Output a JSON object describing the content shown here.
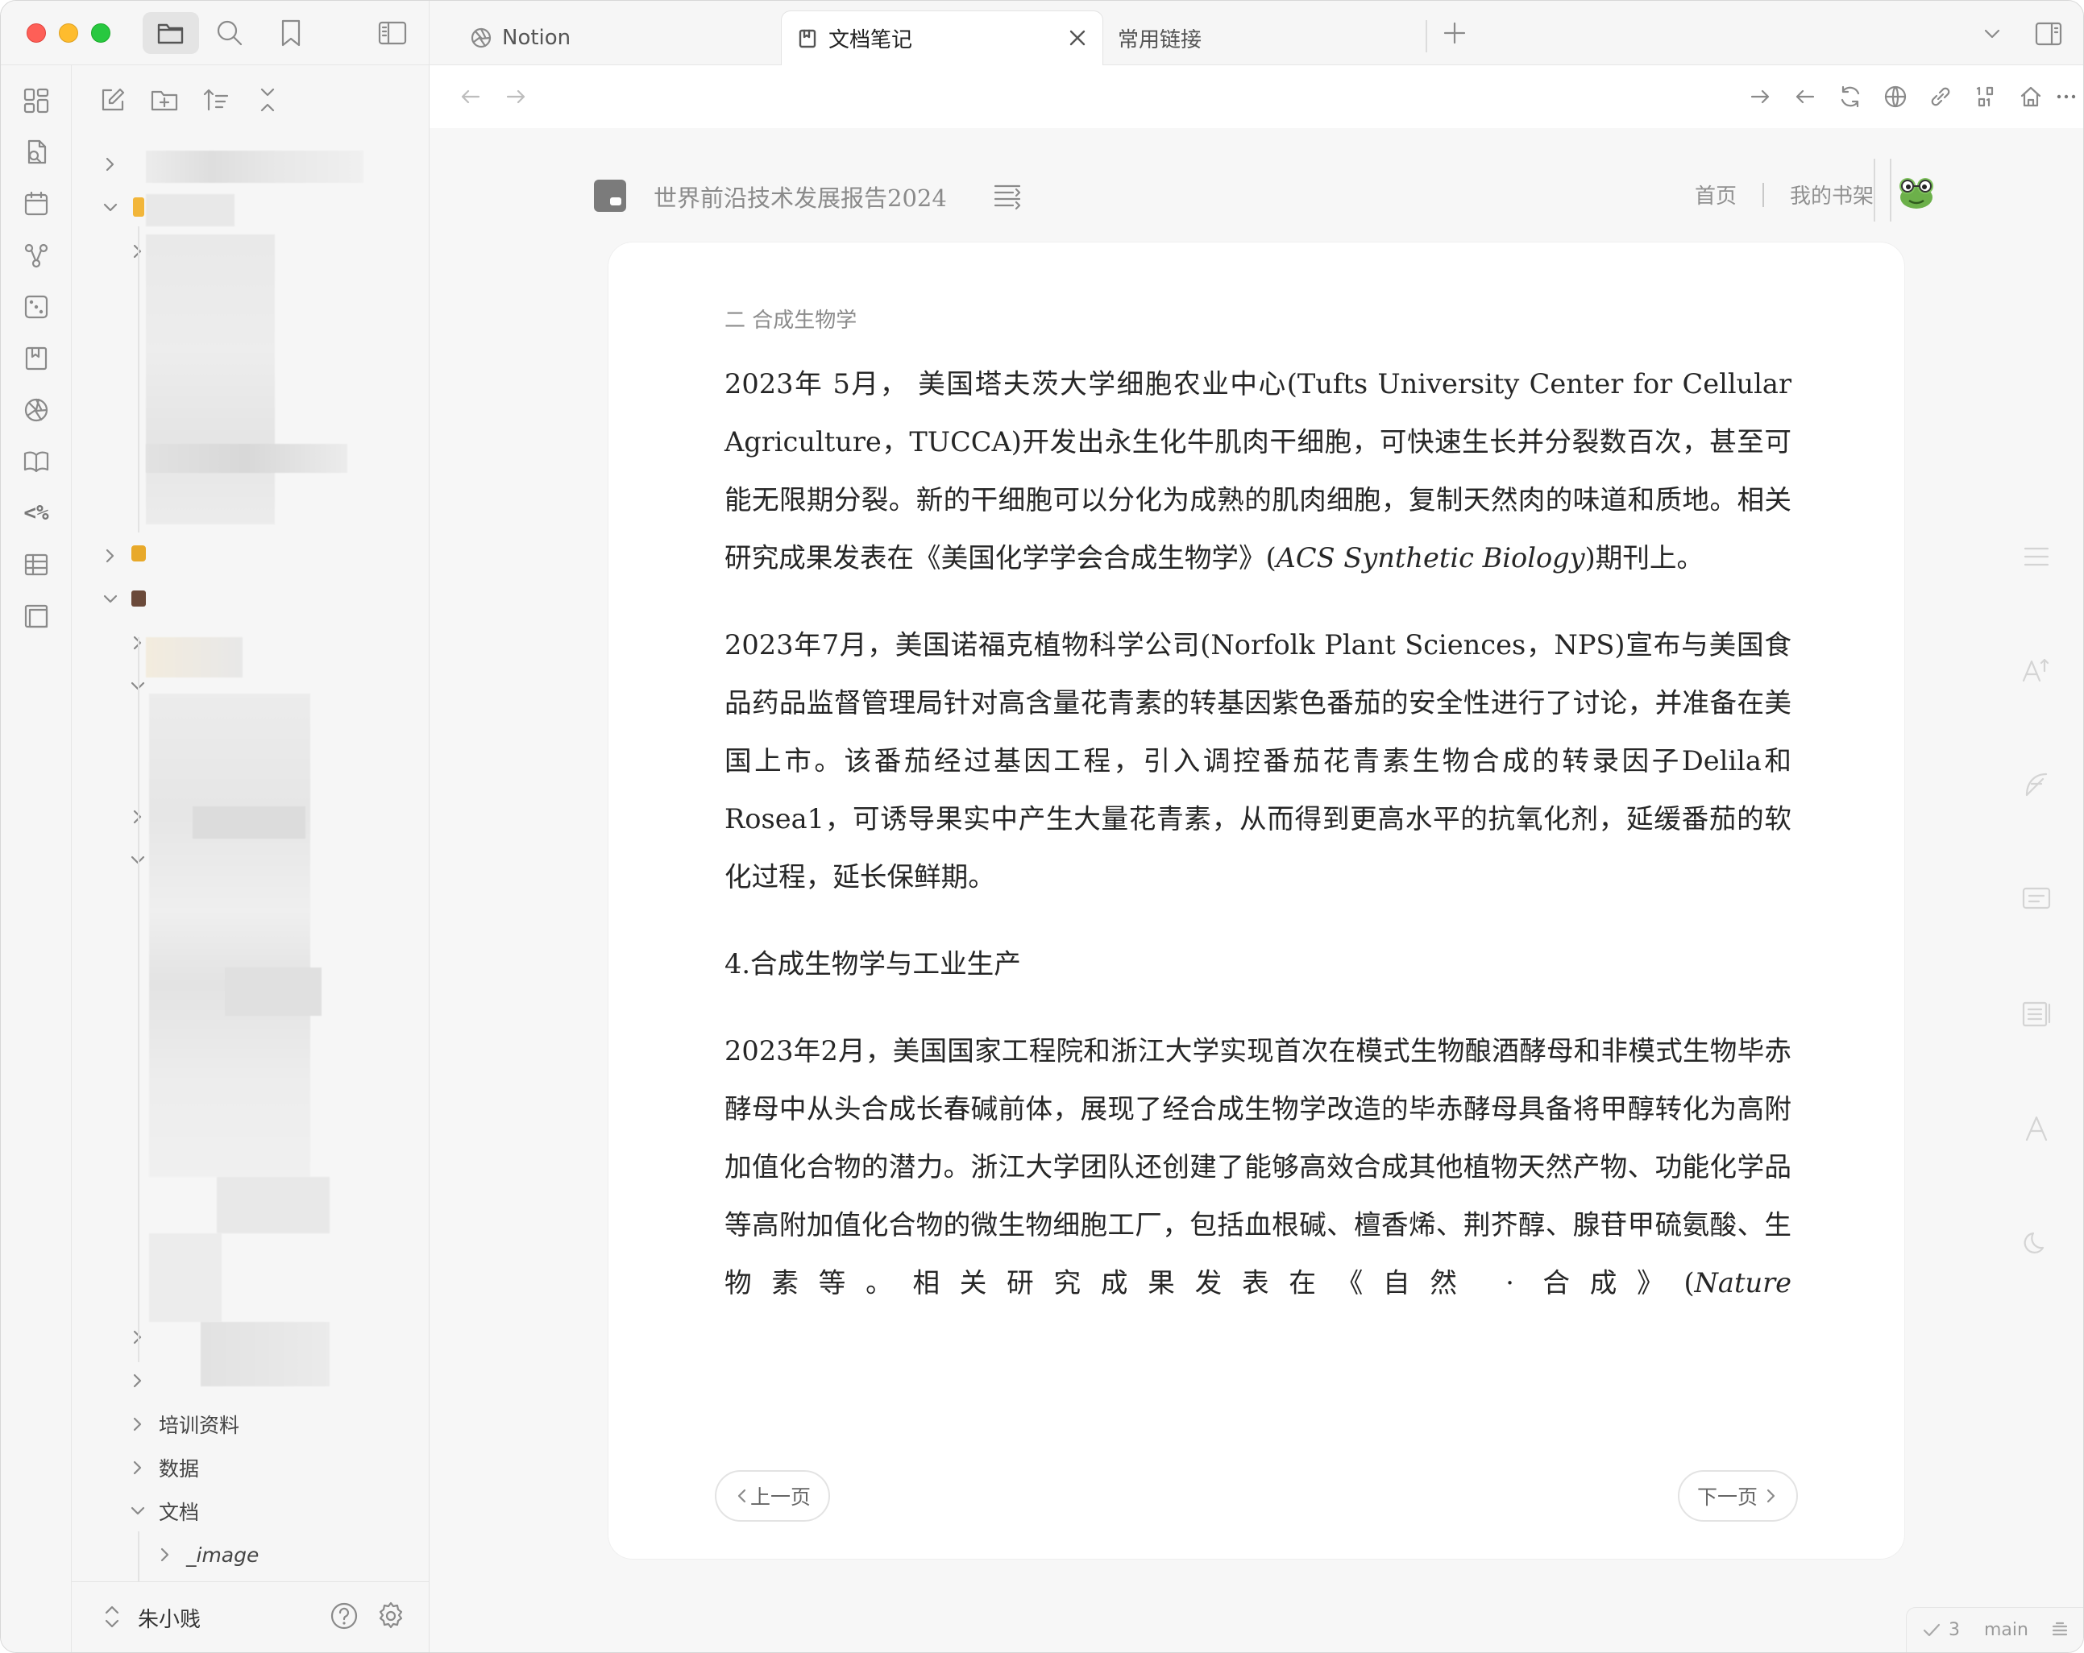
{
  "window": {
    "controls": [
      "close",
      "minimize",
      "zoom"
    ]
  },
  "sidebar": {
    "icons": [
      "file-explorer-icon",
      "search-icon",
      "bookmark-icon",
      "toggle-sidebar-icon"
    ],
    "actions": [
      "new-note-icon",
      "new-folder-icon",
      "sort-icon",
      "collapse-all-icon"
    ],
    "tree_visible_items": [
      {
        "label": "培训资料",
        "expanded": false
      },
      {
        "label": "数据",
        "expanded": false
      },
      {
        "label": "文档",
        "expanded": true
      },
      {
        "label": "_image",
        "expanded": false
      }
    ],
    "vault_name": "朱小贱"
  },
  "tabs": [
    {
      "label": "Notion",
      "icon": "aperture-icon",
      "active": false
    },
    {
      "label": "文档笔记",
      "icon": "book-tab-icon",
      "active": true
    },
    {
      "label": "常用链接",
      "icon": "",
      "active": false
    }
  ],
  "reader": {
    "book_title": "世界前沿技术发展报告2024",
    "links": [
      "首页",
      "我的书架"
    ],
    "chapter": "二 合成生物学",
    "paragraphs": [
      {
        "text_before": "2023年 5月， 美国塔夫茨大学细胞农业中心(Tufts University Center for Cellular Agriculture，TUCCA)开发出永生化牛肌肉干细胞，可快速生长并分裂数百次，甚至可能无限期分裂。新的干细胞可以分化为成熟的肌肉细胞，复制天然肉的味道和质地。相关研究成果发表在《美国化学学会合成生物学》(",
        "italic": "ACS Synthetic Biology",
        "text_after": ")期刊上。"
      },
      {
        "text_before": "2023年7月，美国诺福克植物科学公司(Norfolk Plant Sciences，NPS)宣布与美国食品药品监督管理局针对高含量花青素的转基因紫色番茄的安全性进行了讨论，并准备在美国上市。该番茄经过基因工程，引入调控番茄花青素生物合成的转录因子Delila和Rosea1，可诱导果实中产生大量花青素，从而得到更高水平的抗氧化剂，延缓番茄的软化过程，延长保鲜期。",
        "italic": "",
        "text_after": ""
      },
      {
        "heading": "4.合成生物学与工业生产"
      },
      {
        "text_before": "2023年2月，美国国家工程院和浙江大学实现首次在模式生物酿酒酵母和非模式生物毕赤酵母中从头合成长春碱前体，展现了经合成生物学改造的毕赤酵母具备将甲醇转化为高附加值化合物的潜力。浙江大学团队还创建了能够高效合成其他植物天然产物、功能化学品等高附加值化合物的微生物细胞工厂，包括血根碱、檀香烯、荆芥醇、腺苷甲硫氨酸、生物素等。相关研究成果发表在《自然 · 合成》(",
        "italic": "Nature",
        "text_after": ""
      }
    ],
    "prev_label": "上一页",
    "next_label": "下一页"
  },
  "status": {
    "sync_count": "3",
    "branch": "main"
  }
}
